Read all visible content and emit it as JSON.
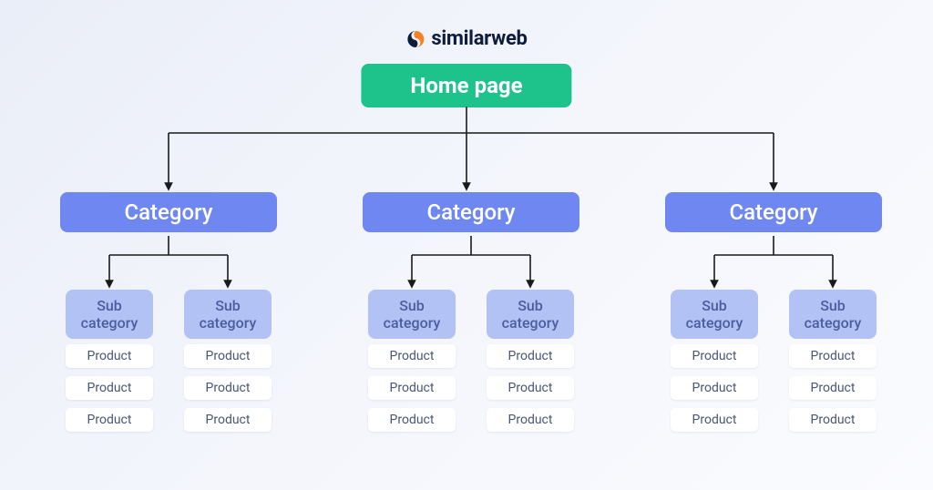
{
  "brand": {
    "name": "similarweb"
  },
  "tree": {
    "root": {
      "label": "Home page"
    },
    "categories": [
      {
        "label": "Category",
        "subcats": [
          {
            "label": "Sub category",
            "products": [
              "Product",
              "Product",
              "Product"
            ]
          },
          {
            "label": "Sub category",
            "products": [
              "Product",
              "Product",
              "Product"
            ]
          }
        ]
      },
      {
        "label": "Category",
        "subcats": [
          {
            "label": "Sub category",
            "products": [
              "Product",
              "Product",
              "Product"
            ]
          },
          {
            "label": "Sub category",
            "products": [
              "Product",
              "Product",
              "Product"
            ]
          }
        ]
      },
      {
        "label": "Category",
        "subcats": [
          {
            "label": "Sub category",
            "products": [
              "Product",
              "Product",
              "Product"
            ]
          },
          {
            "label": "Sub category",
            "products": [
              "Product",
              "Product",
              "Product"
            ]
          }
        ]
      }
    ]
  },
  "colors": {
    "root": "#1ec28b",
    "category": "#6f87f0",
    "subcategory": "#b3c2f5",
    "product_bg": "#ffffff",
    "brand_text": "#0e1c3d",
    "brand_accent1": "#f58220",
    "brand_accent2": "#0e1c3d"
  }
}
